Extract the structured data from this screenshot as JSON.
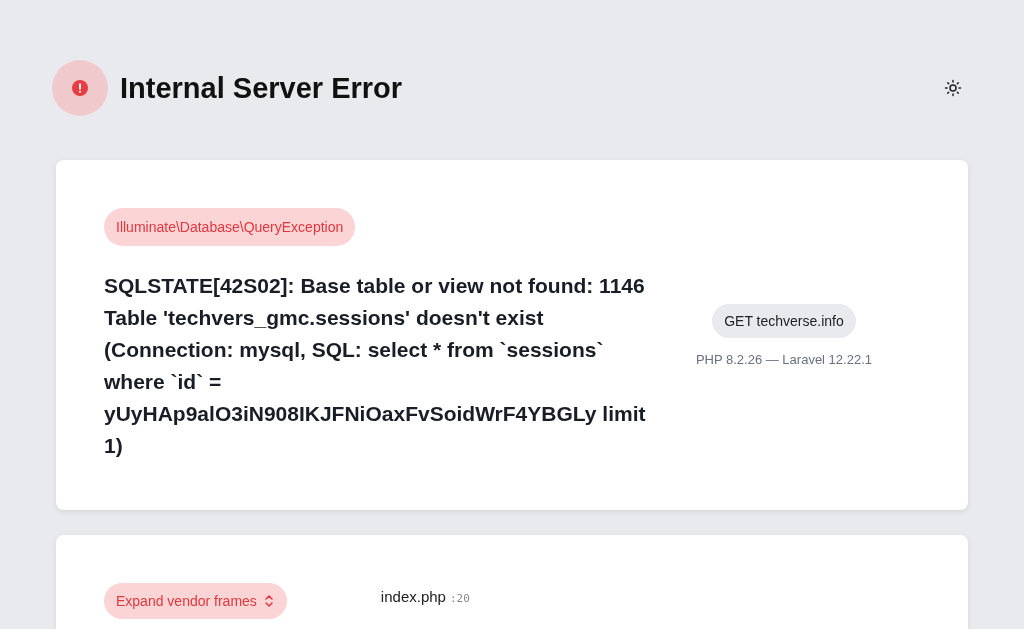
{
  "header": {
    "title": "Internal Server Error"
  },
  "exception": {
    "class": "Illuminate\\Database\\QueryException",
    "message": "SQLSTATE[42S02]: Base table or view not found: 1146 Table 'techvers_gmc.sessions' doesn't exist (Connection: mysql, SQL: select * from `sessions` where `id` = yUyHAp9alO3iN908IKJFNiOaxFvSoidWrF4YBGLy limit 1)",
    "request": "GET techverse.info",
    "versions": "PHP 8.2.26 — Laravel 12.22.1"
  },
  "frames": {
    "expand_label": "Expand vendor frames",
    "first_frame": {
      "file": "index.php",
      "line": ":20"
    }
  }
}
